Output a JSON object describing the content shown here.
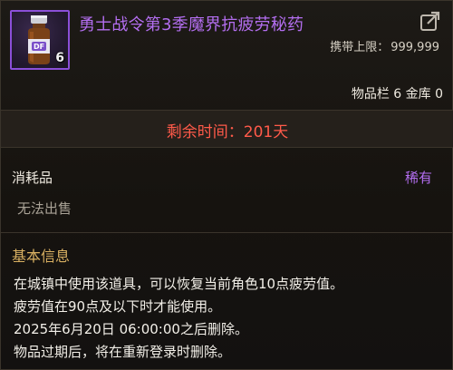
{
  "item": {
    "name": "勇士战令第3季魔界抗疲劳秘药",
    "stack_count": "6",
    "icon": "potion-bottle-icon",
    "name_color": "#b36ef0"
  },
  "header": {
    "carry_limit_label": "携带上限：",
    "carry_limit_value": "999,999",
    "inventory_info": "物品栏 6 金库 0",
    "share_icon": "share-icon"
  },
  "timer": {
    "text": "剩余时间：201天",
    "color": "#ff5a4a"
  },
  "category": {
    "type": "消耗品",
    "rarity": "稀有",
    "trade_status": "无法出售"
  },
  "basic_info": {
    "title": "基本信息",
    "lines": [
      "在城镇中使用该道具，可以恢复当前角色10点疲劳值。",
      "疲劳值在90点及以下时才能使用。",
      "2025年6月20日 06:00:00之后删除。",
      "物品过期后，将在重新登录时删除。"
    ]
  }
}
